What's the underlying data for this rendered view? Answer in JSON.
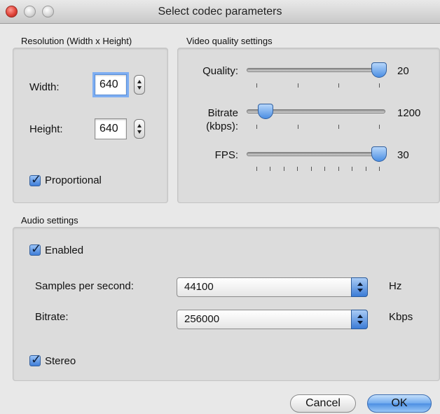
{
  "window": {
    "title": "Select codec parameters"
  },
  "resolution": {
    "group_label": "Resolution (Width x Height)",
    "width_label": "Width:",
    "width_value": "640",
    "height_label": "Height:",
    "height_value": "640",
    "proportional_label": "Proportional",
    "proportional_checked": true
  },
  "video": {
    "group_label": "Video quality settings",
    "quality_label": "Quality:",
    "quality_value": "20",
    "bitrate_label_line1": "Bitrate",
    "bitrate_label_line2": "(kbps):",
    "bitrate_value": "1200",
    "fps_label": "FPS:",
    "fps_value": "30"
  },
  "audio": {
    "group_label": "Audio settings",
    "enabled_label": "Enabled",
    "enabled_checked": true,
    "samples_label": "Samples per second:",
    "samples_value": "44100",
    "samples_unit": "Hz",
    "bitrate_label": "Bitrate:",
    "bitrate_value": "256000",
    "bitrate_unit": "Kbps",
    "stereo_label": "Stereo",
    "stereo_checked": true
  },
  "buttons": {
    "cancel": "Cancel",
    "ok": "OK"
  },
  "colors": {
    "accent": "#4b8ee3",
    "window_bg": "#e8e8e8",
    "group_bg": "#dcdcdc"
  }
}
